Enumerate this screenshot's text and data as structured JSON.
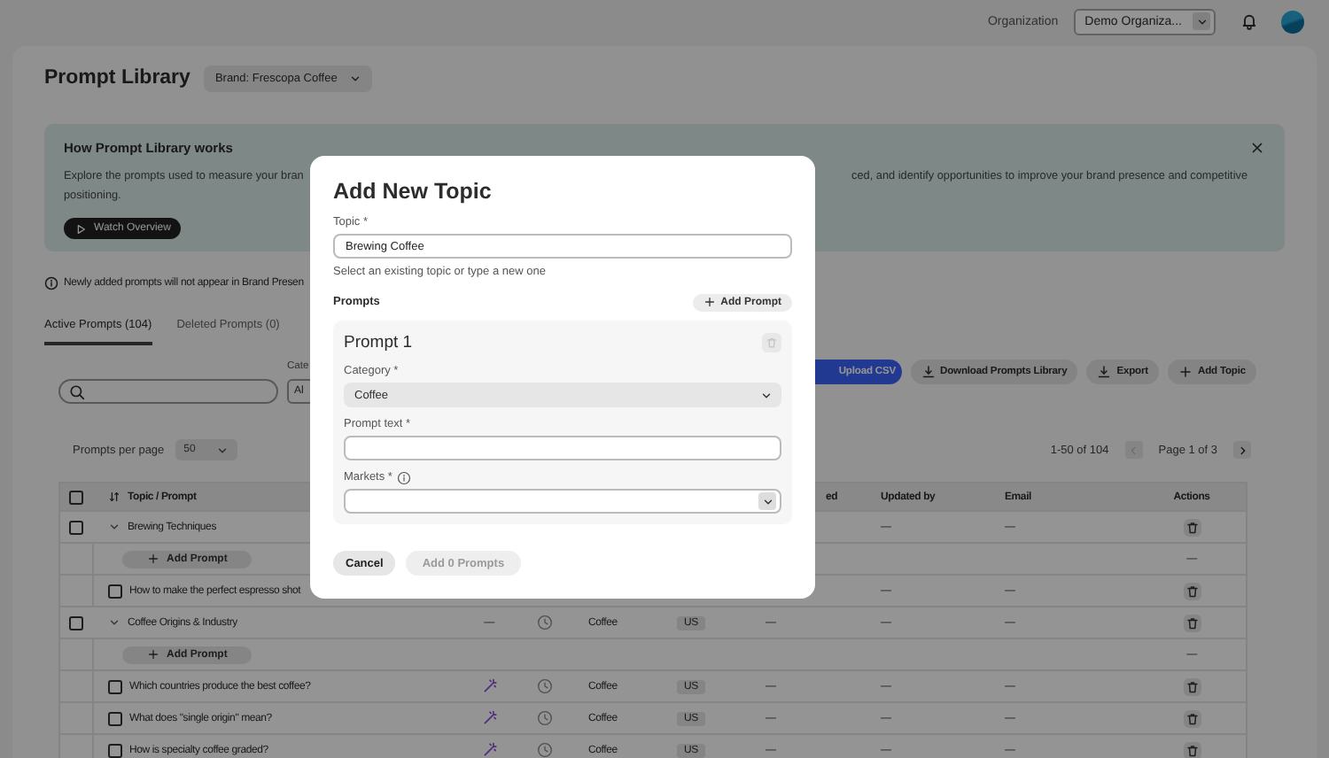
{
  "header": {
    "org_label": "Organization",
    "org_select": "Demo Organiza..."
  },
  "page": {
    "title": "Prompt Library",
    "brand_select": "Brand: Frescopa Coffee"
  },
  "info_banner": {
    "title": "How Prompt Library works",
    "text_left": "Explore the prompts used to measure your bran",
    "text_right": "ced, and identify opportunities to improve your brand presence and competitive",
    "text_line_2": "positioning.",
    "button": "Watch Overview"
  },
  "notice": "Newly added prompts will not appear in Brand Presen",
  "tabs": [
    {
      "label": "Active Prompts (104)",
      "selected": true
    },
    {
      "label": "Deleted Prompts (0)",
      "selected": false
    }
  ],
  "filters": {
    "category_label": "Cate",
    "category_value": "Al"
  },
  "actions": [
    {
      "label": "Upload CSV",
      "kind": "primary"
    },
    {
      "label": "Download Prompts Library",
      "kind": "download"
    },
    {
      "label": "Export",
      "kind": "download"
    },
    {
      "label": "Add Topic",
      "kind": "add"
    }
  ],
  "pagination": {
    "per_page_label": "Prompts per page",
    "per_page": "50",
    "range": "1-50 of 104",
    "page": "Page 1 of 3",
    "prev_disabled": true,
    "next_disabled": false
  },
  "table": {
    "select_all_checked": false,
    "columns": {
      "topic": "Topic / Prompt",
      "last_updated": "ed",
      "updated_by": "Updated by",
      "email": "Email",
      "actions": "Actions"
    },
    "rows": [
      {
        "kind": "group",
        "checked": false,
        "expanded": true,
        "label": "Brewing Techniques",
        "updated_by": "—",
        "email": "—",
        "delete": true
      },
      {
        "kind": "add",
        "label": "Add Prompt",
        "action_text": "—"
      },
      {
        "kind": "prompt",
        "checked": false,
        "label": "How to make the perfect espresso shot",
        "updated_by": "—",
        "email": "—",
        "delete": true
      },
      {
        "kind": "group",
        "checked": false,
        "expanded": true,
        "label": "Coffee Origins & Industry",
        "source": "—",
        "history": true,
        "category": "Coffee",
        "market": "US",
        "last_updated": "—",
        "updated_by": "—",
        "email": "—",
        "delete": true
      },
      {
        "kind": "add",
        "label": "Add Prompt",
        "action_text": "—"
      },
      {
        "kind": "prompt",
        "checked": false,
        "label": "Which countries produce the best coffee?",
        "generated": true,
        "history": true,
        "category": "Coffee",
        "market": "US",
        "last_updated": "—",
        "updated_by": "—",
        "email": "—",
        "delete": true
      },
      {
        "kind": "prompt",
        "checked": false,
        "label": "What does \"single origin\" mean?",
        "generated": true,
        "history": true,
        "category": "Coffee",
        "market": "US",
        "last_updated": "—",
        "updated_by": "—",
        "email": "—",
        "delete": true
      },
      {
        "kind": "prompt",
        "checked": false,
        "label": "How is specialty coffee graded?",
        "generated": true,
        "history": true,
        "category": "Coffee",
        "market": "US",
        "last_updated": "—",
        "updated_by": "—",
        "email": "—",
        "delete": true
      }
    ]
  },
  "modal": {
    "title": "Add New Topic",
    "topic_label": "Topic *",
    "topic_value": "Brewing Coffee",
    "topic_hint": "Select an existing topic or type a new one",
    "prompts_label": "Prompts",
    "add_prompt": "Add Prompt",
    "prompts": [
      {
        "title": "Prompt 1",
        "category_label": "Category *",
        "category": "Coffee",
        "text_label": "Prompt text *",
        "markets_label": "Markets *"
      }
    ],
    "cancel": "Cancel",
    "submit": "Add 0 Prompts",
    "submit_disabled": true
  }
}
